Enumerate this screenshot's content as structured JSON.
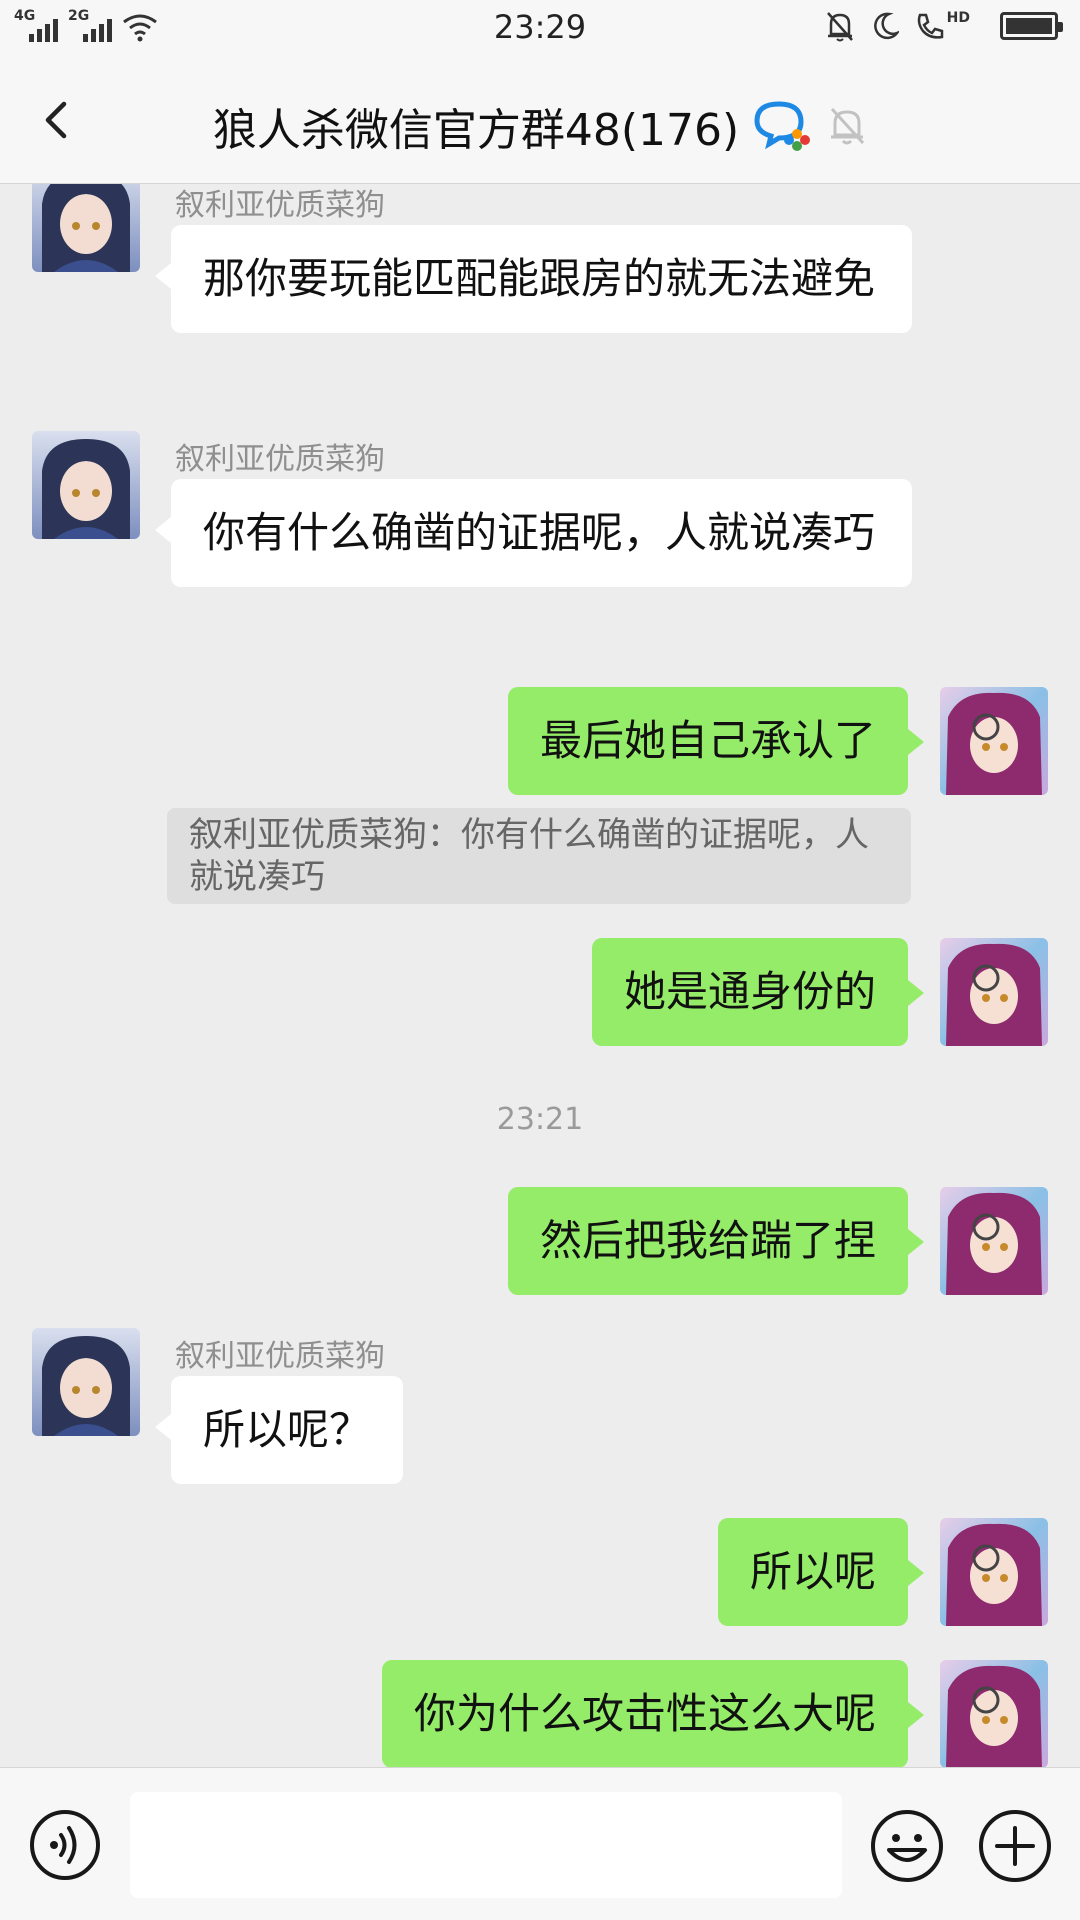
{
  "status_bar": {
    "time": "23:29",
    "network_1": "4G",
    "network_2": "2G",
    "hd": "HD"
  },
  "header": {
    "title": "狼人杀微信官方群48(176)",
    "icons": [
      "back-chevron-icon",
      "enterprise-chat-icon",
      "mute-bell-icon"
    ]
  },
  "messages": [
    {
      "type": "incoming",
      "sender": "叙利亚优质菜狗",
      "text": "那你要玩能匹配能跟房的就无法避免"
    },
    {
      "type": "incoming",
      "sender": "叙利亚优质菜狗",
      "text": "你有什么确凿的证据呢，人就说凑巧"
    },
    {
      "type": "outgoing",
      "text": "最后她自己承认了"
    },
    {
      "type": "quote",
      "text": "叙利亚优质菜狗：你有什么确凿的证据呢，人就说凑巧"
    },
    {
      "type": "outgoing",
      "text": "她是通身份的"
    },
    {
      "type": "timestamp",
      "text": "23:21"
    },
    {
      "type": "outgoing",
      "text": "然后把我给踹了捏"
    },
    {
      "type": "incoming",
      "sender": "叙利亚优质菜狗",
      "text": "所以呢？"
    },
    {
      "type": "outgoing",
      "text": "所以呢"
    },
    {
      "type": "outgoing",
      "text": "你为什么攻击性这么大呢"
    }
  ],
  "input_bar": {
    "text_value": "",
    "icons": [
      "voice-icon",
      "emoji-icon",
      "plus-icon"
    ]
  },
  "colors": {
    "outgoing_bubble": "#95ec69",
    "incoming_bubble": "#ffffff",
    "background": "#ededed",
    "bar": "#f7f7f7"
  }
}
